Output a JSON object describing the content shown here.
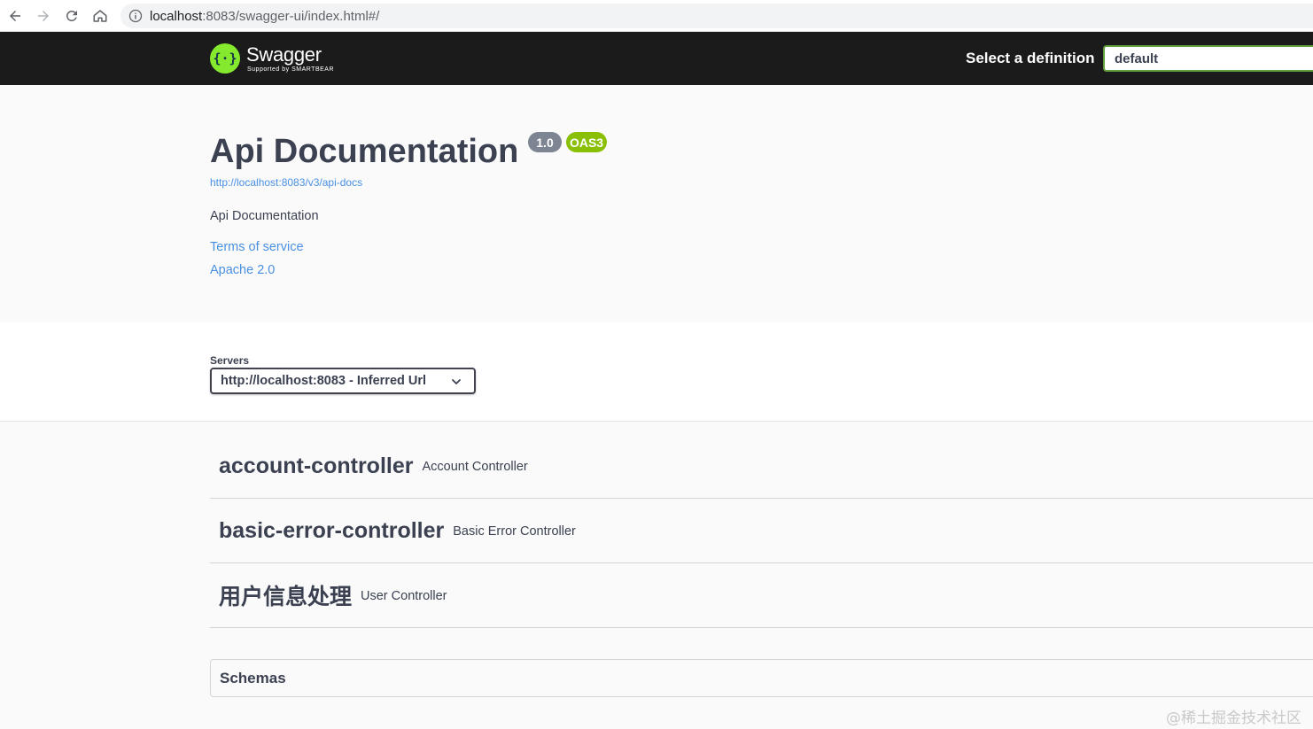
{
  "browser": {
    "url_host": "localhost",
    "url_rest": ":8083/swagger-ui/index.html#/"
  },
  "topbar": {
    "logo_name": "Swagger",
    "logo_sub": "Supported by SMARTBEAR",
    "select_label": "Select a definition",
    "definition_value": "default",
    "colors": {
      "background": "#1b1b1b",
      "logo": "#85ea2d",
      "select_border": "#62a03f"
    }
  },
  "info": {
    "title": "Api Documentation",
    "version_badge": "1.0",
    "oas_badge": "OAS3",
    "api_docs_url": "http://localhost:8083/v3/api-docs",
    "description": "Api Documentation",
    "terms_link": "Terms of service",
    "license_link": "Apache 2.0"
  },
  "servers": {
    "label": "Servers",
    "selected": "http://localhost:8083 - Inferred Url"
  },
  "tags": [
    {
      "name": "account-controller",
      "description": "Account Controller"
    },
    {
      "name": "basic-error-controller",
      "description": "Basic Error Controller"
    },
    {
      "name": "用户信息处理",
      "description": "User Controller"
    }
  ],
  "schemas": {
    "label": "Schemas"
  },
  "watermark": "@稀土掘金技术社区",
  "icons": [
    "back-arrow-icon",
    "forward-arrow-icon",
    "reload-icon",
    "home-icon",
    "info-icon",
    "swagger-logo-icon",
    "chevron-down-icon"
  ]
}
